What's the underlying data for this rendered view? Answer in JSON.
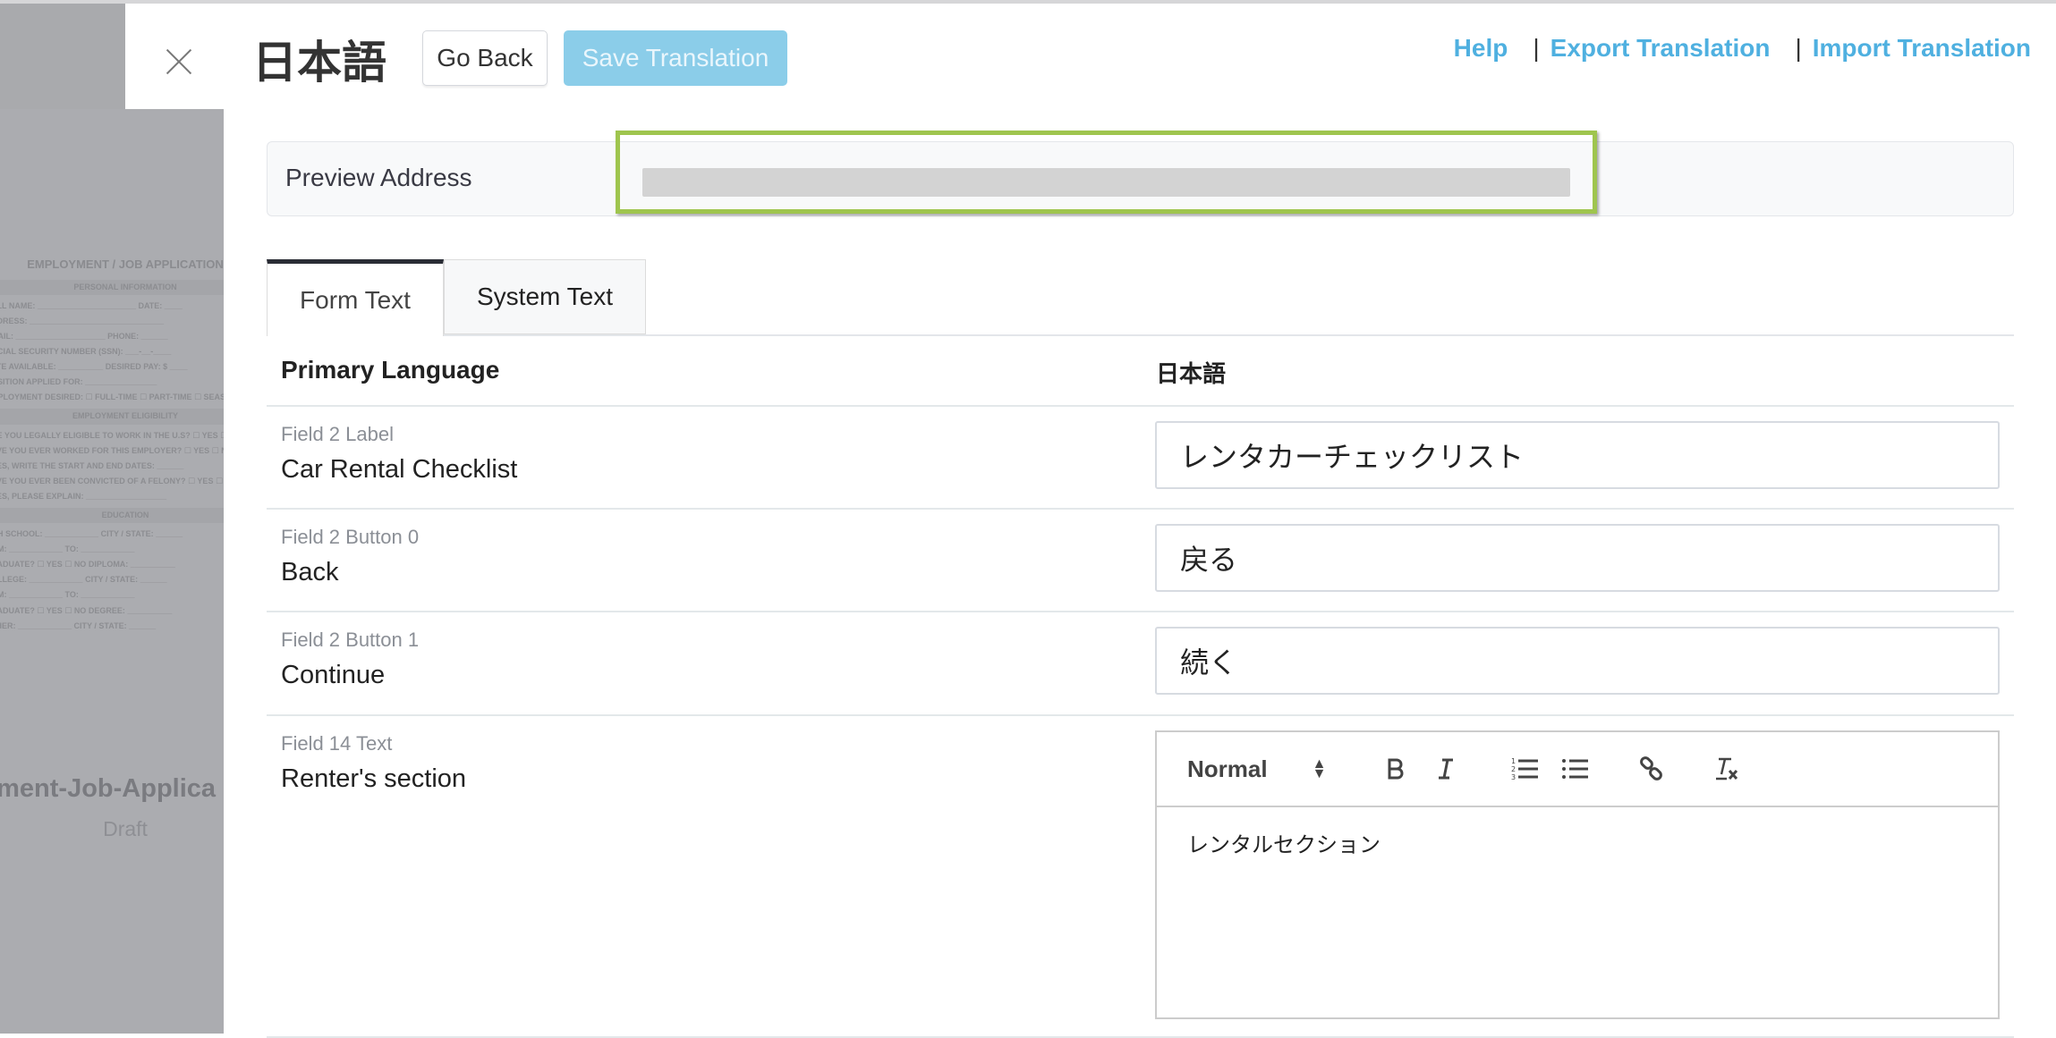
{
  "background_preview": {
    "document_heading": "EMPLOYMENT / JOB APPLICATION",
    "sections": [
      "PERSONAL INFORMATION",
      "EMPLOYMENT ELIGIBILITY",
      "EDUCATION"
    ],
    "personal_lines": [
      "ULL NAME: ______________________ DATE: ____",
      "DDRESS: ______________________________",
      "MAIL: ____________________ PHONE: ______",
      "OCIAL SECURITY NUMBER (SSN): ___-__-____",
      "ATE AVAILABLE: __________ DESIRED PAY: $ ____",
      "OSITION APPLIED FOR: ________________",
      "MPLOYMENT DESIRED: ☐ FULL-TIME ☐ PART-TIME ☐ SEASONAL"
    ],
    "eligibility_lines": [
      "RE YOU LEGALLY ELIGIBLE TO WORK IN THE U.S? ☐ YES ☐ NO",
      "AVE YOU EVER WORKED FOR THIS EMPLOYER? ☐ YES ☐ NO",
      "YES, WRITE THE START AND END DATES: ______",
      "AVE YOU EVER BEEN CONVICTED OF A FELONY? ☐ YES ☐ NO",
      "YES, PLEASE EXPLAIN: __________________"
    ],
    "education_lines": [
      "GH SCHOOL: ____________ CITY / STATE: ______",
      "OM: ____________ TO: ____________",
      "RADUATE? ☐ YES ☐ NO DIPLOMA: __________",
      "OLLEGE: ____________ CITY / STATE: ______",
      "OM: ____________ TO: ____________",
      "RADUATE? ☐ YES ☐ NO DEGREE: __________",
      "THER: ____________ CITY / STATE: ______"
    ],
    "form_name": "yment-Job-Applica",
    "form_status": "Draft"
  },
  "header": {
    "close_icon": "close-x-icon",
    "title": "日本語",
    "go_back_label": "Go Back",
    "save_label": "Save Translation",
    "links": [
      {
        "label": "Help"
      },
      {
        "label": "Export Translation"
      },
      {
        "label": "Import Translation"
      }
    ],
    "link_color": "#4fb0e0",
    "save_color": "#8bcde9"
  },
  "preview": {
    "label": "Preview Address",
    "value": "",
    "highlight_color": "#9fc54e"
  },
  "tabs": [
    {
      "label": "Form Text",
      "active": true
    },
    {
      "label": "System Text",
      "active": false
    }
  ],
  "table": {
    "col_primary": "Primary Language",
    "col_target": "日本語",
    "rows": [
      {
        "meta": "Field 2 Label",
        "source": "Car Rental Checklist",
        "translation": "レンタカーチェックリスト"
      },
      {
        "meta": "Field 2 Button 0",
        "source": "Back",
        "translation": "戻る"
      },
      {
        "meta": "Field 2 Button 1",
        "source": "Continue",
        "translation": "続く"
      },
      {
        "meta": "Field 14 Text",
        "source": "Renter's section",
        "translation": "レンタルセクション"
      }
    ]
  },
  "editor": {
    "format_select": "Normal",
    "tools": [
      "bold-icon",
      "italic-icon",
      "ordered-list-icon",
      "bullet-list-icon",
      "link-icon",
      "clear-format-icon"
    ]
  }
}
